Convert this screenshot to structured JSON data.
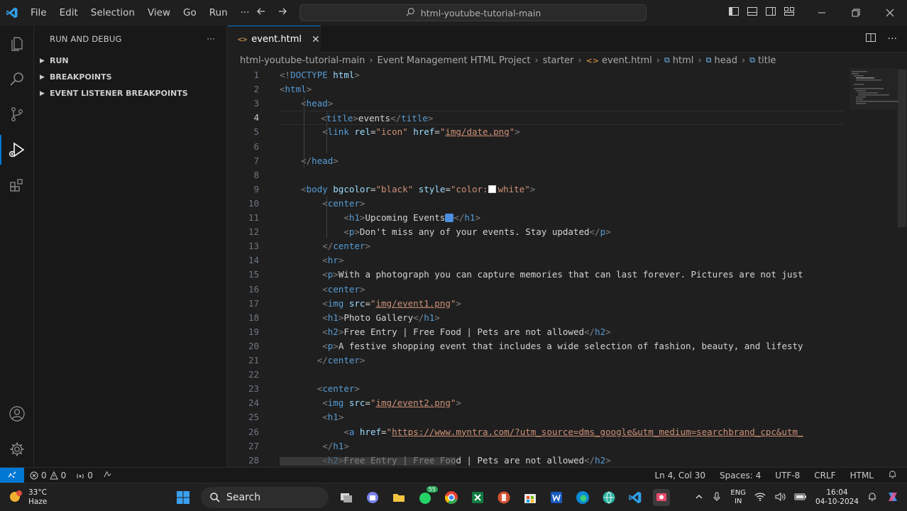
{
  "titlebar": {
    "menu": [
      "File",
      "Edit",
      "Selection",
      "View",
      "Go",
      "Run",
      "···"
    ],
    "command_center": "html-youtube-tutorial-main"
  },
  "sidebar": {
    "title": "RUN AND DEBUG",
    "more": "···",
    "sections": [
      "RUN",
      "BREAKPOINTS",
      "EVENT LISTENER BREAKPOINTS"
    ]
  },
  "editor": {
    "tab_label": "event.html",
    "breadcrumb": [
      "html-youtube-tutorial-main",
      "Event Management HTML Project",
      "starter",
      "event.html",
      "html",
      "head",
      "title"
    ],
    "current_line": 4,
    "lines": [
      {
        "n": "1",
        "html": "<span class='b'>&lt;!</span><span class='t'>DOCTYPE</span> <span class='a'>html</span><span class='b'>&gt;</span>"
      },
      {
        "n": "2",
        "html": "<span class='b'>&lt;</span><span class='t'>html</span><span class='b'>&gt;</span>"
      },
      {
        "n": "3",
        "html": "    <span class='b'>&lt;</span><span class='t'>head</span><span class='b'>&gt;</span>"
      },
      {
        "n": "4",
        "html": "        <span class='b'>&lt;</span><span class='t'>title</span><span class='b'>&gt;</span><span class='x'>events</span><span class='b'>&lt;/</span><span class='t'>title</span><span class='b'>&gt;</span>"
      },
      {
        "n": "5",
        "html": "        <span class='b'>&lt;</span><span class='t'>link</span> <span class='a'>rel</span><span class='x'>=</span><span class='s'>\"icon\"</span> <span class='a'>href</span><span class='x'>=</span><span class='s'>\"<span class='u'>img/date.png</span>\"</span><span class='b'>&gt;</span>"
      },
      {
        "n": "6",
        "html": ""
      },
      {
        "n": "7",
        "html": "    <span class='b'>&lt;/</span><span class='t'>head</span><span class='b'>&gt;</span>"
      },
      {
        "n": "8",
        "html": ""
      },
      {
        "n": "9",
        "html": "    <span class='b'>&lt;</span><span class='t'>body</span> <span class='a'>bgcolor</span><span class='x'>=</span><span class='s'>\"black\"</span> <span class='a'>style</span><span class='x'>=</span><span class='s'>\"color:<span class='sw'></span>white\"</span><span class='b'>&gt;</span>"
      },
      {
        "n": "10",
        "html": "        <span class='b'>&lt;</span><span class='t'>center</span><span class='b'>&gt;</span>"
      },
      {
        "n": "11",
        "html": "            <span class='b'>&lt;</span><span class='t'>h1</span><span class='b'>&gt;</span><span class='x'>Upcoming Events</span><span class='cal'></span><span class='b'>&lt;/</span><span class='t'>h1</span><span class='b'>&gt;</span>"
      },
      {
        "n": "12",
        "html": "            <span class='b'>&lt;</span><span class='t'>p</span><span class='b'>&gt;</span><span class='x'>Don't miss any of your events. Stay updated</span><span class='b'>&lt;/</span><span class='t'>p</span><span class='b'>&gt;</span>"
      },
      {
        "n": "13",
        "html": "        <span class='b'>&lt;/</span><span class='t'>center</span><span class='b'>&gt;</span>"
      },
      {
        "n": "14",
        "html": "        <span class='b'>&lt;</span><span class='t'>hr</span><span class='b'>&gt;</span>"
      },
      {
        "n": "15",
        "html": "        <span class='b'>&lt;</span><span class='t'>p</span><span class='b'>&gt;</span><span class='x'>With a photograph you can capture memories that can last forever. Pictures are not just</span>"
      },
      {
        "n": "16",
        "html": "        <span class='b'>&lt;</span><span class='t'>center</span><span class='b'>&gt;</span>"
      },
      {
        "n": "17",
        "html": "        <span class='b'>&lt;</span><span class='t'>img</span> <span class='a'>src</span><span class='x'>=</span><span class='s'>\"<span class='u'>img/event1.png</span>\"</span><span class='b'>&gt;</span>"
      },
      {
        "n": "18",
        "html": "        <span class='b'>&lt;</span><span class='t'>h1</span><span class='b'>&gt;</span><span class='x'>Photo Gallery</span><span class='b'>&lt;/</span><span class='t'>h1</span><span class='b'>&gt;</span>"
      },
      {
        "n": "19",
        "html": "        <span class='b'>&lt;</span><span class='t'>h2</span><span class='b'>&gt;</span><span class='x'>Free Entry | Free Food | Pets are not allowed</span><span class='b'>&lt;/</span><span class='t'>h2</span><span class='b'>&gt;</span>"
      },
      {
        "n": "20",
        "html": "        <span class='b'>&lt;</span><span class='t'>p</span><span class='b'>&gt;</span><span class='x'>A festive shopping event that includes a wide selection of fashion, beauty, and lifesty</span>"
      },
      {
        "n": "21",
        "html": "       <span class='b'>&lt;/</span><span class='t'>center</span><span class='b'>&gt;</span>"
      },
      {
        "n": "22",
        "html": ""
      },
      {
        "n": "23",
        "html": "       <span class='b'>&lt;</span><span class='t'>center</span><span class='b'>&gt;</span>"
      },
      {
        "n": "24",
        "html": "        <span class='b'>&lt;</span><span class='t'>img</span> <span class='a'>src</span><span class='x'>=</span><span class='s'>\"<span class='u'>img/event2.png</span>\"</span><span class='b'>&gt;</span>"
      },
      {
        "n": "25",
        "html": "        <span class='b'>&lt;</span><span class='t'>h1</span><span class='b'>&gt;</span>"
      },
      {
        "n": "26",
        "html": "            <span class='b'>&lt;</span><span class='t'>a</span> <span class='a'>href</span><span class='x'>=</span><span class='s'>\"<span class='u'>https://www.myntra.com/?utm_source=dms_google&amp;utm_medium=searchbrand_cpc&amp;utm_</span></span>"
      },
      {
        "n": "27",
        "html": "        <span class='b'>&lt;/</span><span class='t'>h1</span><span class='b'>&gt;</span>"
      },
      {
        "n": "28",
        "html": "        <span class='b'>&lt;</span><span class='t'>h2</span><span class='b'>&gt;</span><span class='x'>Free Entry | Free Food | Pets are not allowed</span><span class='b'>&lt;/</span><span class='t'>h2</span><span class='b'>&gt;</span>"
      }
    ]
  },
  "statusbar": {
    "errors": "0",
    "warnings": "0",
    "ports": "0",
    "cursor": "Ln 4, Col 30",
    "spaces": "Spaces: 4",
    "encoding": "UTF-8",
    "eol": "CRLF",
    "language": "HTML"
  },
  "taskbar": {
    "weather_temp": "33°C",
    "weather_desc": "Haze",
    "search_label": "Search",
    "whatsapp_badge": "55",
    "lang_line1": "ENG",
    "lang_line2": "IN",
    "time": "16:04",
    "date": "04-10-2024"
  },
  "colors": {
    "accent": "#0078d4",
    "tag": "#569cd6",
    "attribute": "#9cdcfe",
    "string": "#ce9178"
  }
}
